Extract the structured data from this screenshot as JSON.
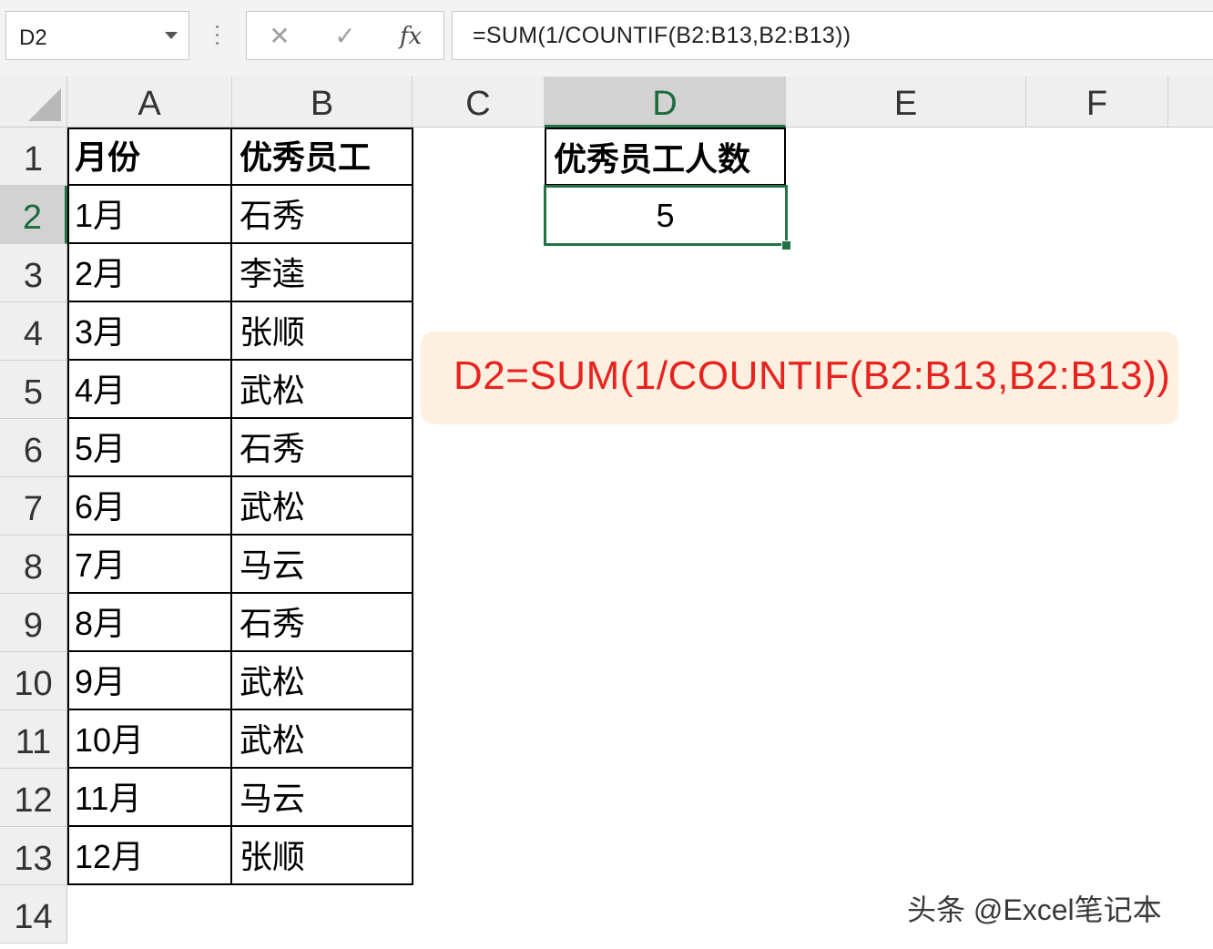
{
  "namebox": {
    "value": "D2"
  },
  "formula_bar": {
    "cancel_glyph": "✕",
    "enter_glyph": "✓",
    "fx_glyph": "fx",
    "formula": "=SUM(1/COUNTIF(B2:B13,B2:B13))"
  },
  "columns": [
    "A",
    "B",
    "C",
    "D",
    "E",
    "F"
  ],
  "rows": [
    "1",
    "2",
    "3",
    "4",
    "5",
    "6",
    "7",
    "8",
    "9",
    "10",
    "11",
    "12",
    "13",
    "14"
  ],
  "table": {
    "header": {
      "month": "月份",
      "employee": "优秀员工"
    },
    "records": [
      {
        "month": "1月",
        "employee": "石秀"
      },
      {
        "month": "2月",
        "employee": "李逵"
      },
      {
        "month": "3月",
        "employee": "张顺"
      },
      {
        "month": "4月",
        "employee": "武松"
      },
      {
        "month": "5月",
        "employee": "石秀"
      },
      {
        "month": "6月",
        "employee": "武松"
      },
      {
        "month": "7月",
        "employee": "马云"
      },
      {
        "month": "8月",
        "employee": "石秀"
      },
      {
        "month": "9月",
        "employee": "武松"
      },
      {
        "month": "10月",
        "employee": "武松"
      },
      {
        "month": "11月",
        "employee": "马云"
      },
      {
        "month": "12月",
        "employee": "张顺"
      }
    ]
  },
  "result": {
    "header": "优秀员工人数",
    "value": "5"
  },
  "callout": {
    "text": "D2=SUM(1/COUNTIF(B2:B13,B2:B13))"
  },
  "watermark": {
    "text": "头条 @Excel笔记本"
  },
  "colors": {
    "selection": "#217346",
    "callout_text": "#e8231f",
    "callout_bg": "#fdf0e0"
  }
}
